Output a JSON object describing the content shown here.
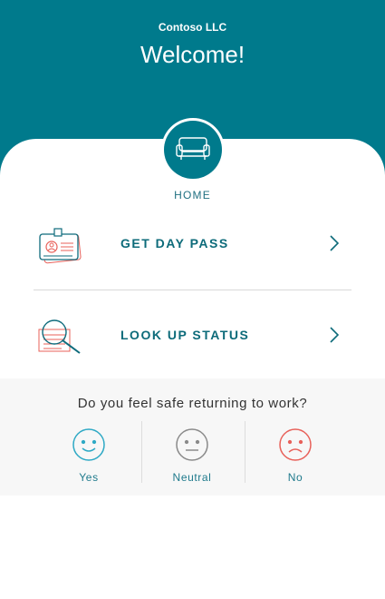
{
  "header": {
    "company": "Contoso LLC",
    "welcome": "Welcome!"
  },
  "home": {
    "label": "HOME",
    "icon": "couch-icon"
  },
  "menu": [
    {
      "label": "GET DAY PASS",
      "icon": "id-badge-icon"
    },
    {
      "label": "LOOK UP STATUS",
      "icon": "document-search-icon"
    }
  ],
  "survey": {
    "question": "Do you feel safe returning to work?",
    "options": [
      {
        "label": "Yes",
        "icon": "smiley-happy-icon",
        "color": "#2ea9c5"
      },
      {
        "label": "Neutral",
        "icon": "smiley-neutral-icon",
        "color": "#8a8a8a"
      },
      {
        "label": "No",
        "icon": "smiley-sad-icon",
        "color": "#e8615a"
      }
    ]
  },
  "colors": {
    "brand": "#007a8c",
    "accent_text": "#0d6b7a"
  }
}
